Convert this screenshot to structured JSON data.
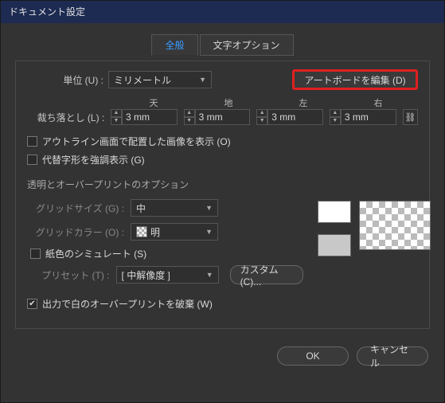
{
  "title": "ドキュメント設定",
  "tabs": {
    "general": "全般",
    "typography": "文字オプション"
  },
  "units": {
    "label": "単位 (U) :",
    "value": "ミリメートル"
  },
  "edit_artboards": "アートボードを編集 (D)",
  "bleed": {
    "label": "裁ち落とし (L) :",
    "top_h": "天",
    "bottom_h": "地",
    "left_h": "左",
    "right_h": "右",
    "top": "3 mm",
    "bottom": "3 mm",
    "left": "3 mm",
    "right": "3 mm"
  },
  "outline_images": "アウトライン画面で配置した画像を表示 (O)",
  "alt_glyphs": "代替字形を強調表示 (G)",
  "transparency_section": "透明とオーバープリントのオプション",
  "grid_size": {
    "label": "グリッドサイズ (G) :",
    "value": "中"
  },
  "grid_color": {
    "label": "グリッドカラー (O) :",
    "value": "明"
  },
  "simulate_paper": "紙色のシミュレート (S)",
  "preset": {
    "label": "プリセット (T) :",
    "value": "[ 中解像度 ]"
  },
  "custom_btn": "カスタム (C)...",
  "discard_white_overprint": "出力で白のオーバープリントを破棄 (W)",
  "ok": "OK",
  "cancel": "キャンセル"
}
